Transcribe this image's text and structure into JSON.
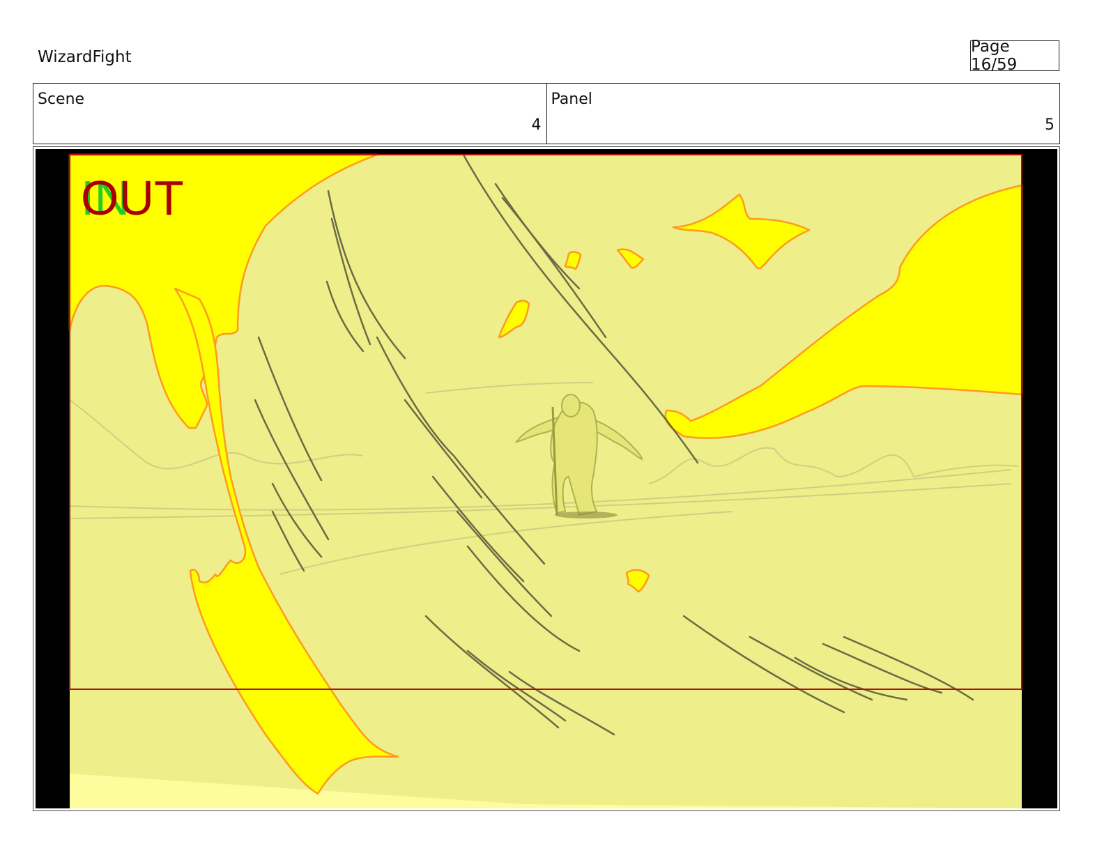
{
  "header": {
    "project_title": "WizardFight",
    "page_label": "Page 16/59"
  },
  "info": {
    "scene_label": "Scene",
    "scene_value": "4",
    "panel_label": "Panel",
    "panel_value": "5"
  },
  "panel": {
    "transition_in_label": "IN",
    "transition_out_label": "OUT",
    "colors": {
      "background": "#eeee8a",
      "energy": "#ffff00",
      "energy_outline": "#ff9a1e",
      "frame_line": "#b01010",
      "in_text": "#22cc22",
      "out_text": "#a80000",
      "letterbox": "#000000"
    }
  }
}
